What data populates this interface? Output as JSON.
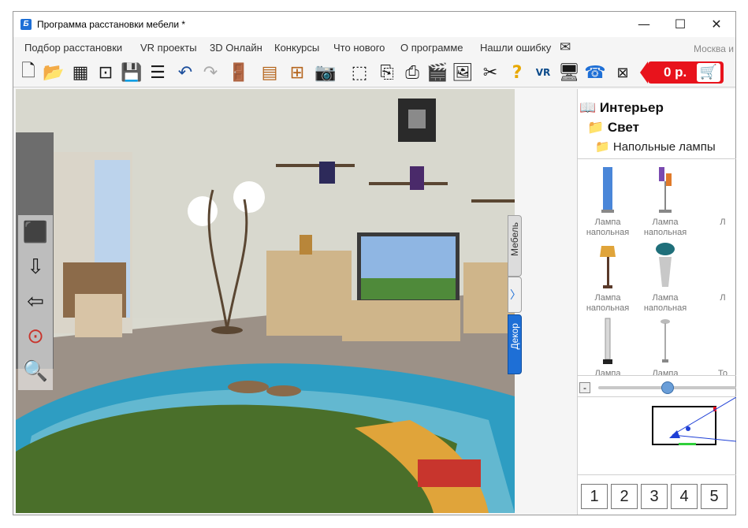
{
  "window": {
    "title": "Программа расстановки мебели *",
    "app_icon_letter": "Б",
    "minimize_glyph": "—",
    "maximize_glyph": "☐",
    "close_glyph": "✕"
  },
  "menu": {
    "items": [
      "Подбор расстановки",
      "VR проекты",
      "3D Онлайн",
      "Конкурсы",
      "Что нового",
      "О программе",
      "Нашли ошибку"
    ],
    "mail_icon": "✉",
    "city": "Москва и"
  },
  "toolbar": {
    "icons": [
      {
        "name": "new-file-icon",
        "glyph": "🗋"
      },
      {
        "name": "open-folder-icon",
        "glyph": "📂"
      },
      {
        "name": "plan-icon",
        "glyph": "▦"
      },
      {
        "name": "zoom-page-icon",
        "glyph": "⊡"
      },
      {
        "name": "save-icon",
        "glyph": "💾"
      },
      {
        "name": "list-icon",
        "glyph": "☰"
      },
      {
        "name": "undo-icon",
        "glyph": "↶"
      },
      {
        "name": "redo-icon",
        "glyph": "↷"
      },
      {
        "name": "door-icon",
        "glyph": "🚪"
      },
      {
        "name": "shelf-icon",
        "glyph": "▤"
      },
      {
        "name": "cabinet-icon",
        "glyph": "⊞"
      },
      {
        "name": "camera-icon",
        "glyph": "📷"
      },
      {
        "name": "cube-wire-icon",
        "glyph": "⬚"
      },
      {
        "name": "export-icon",
        "glyph": "⎘"
      },
      {
        "name": "print-icon",
        "glyph": "⎙"
      },
      {
        "name": "video-icon",
        "glyph": "🎬"
      },
      {
        "name": "image-icon",
        "glyph": "🖼"
      },
      {
        "name": "tools-icon",
        "glyph": "✂"
      },
      {
        "name": "help-icon",
        "glyph": "?"
      },
      {
        "name": "vr-icon",
        "glyph": "VR"
      },
      {
        "name": "monitor-icon",
        "glyph": "🖥"
      },
      {
        "name": "phone-icon",
        "glyph": "☎"
      },
      {
        "name": "close-box-icon",
        "glyph": "⊠"
      }
    ],
    "price": "0 р.",
    "cart_glyph": "🛒"
  },
  "viewport": {
    "tools": [
      {
        "name": "cube-view-icon",
        "glyph": "⬛"
      },
      {
        "name": "move-down-icon",
        "glyph": "⇩"
      },
      {
        "name": "move-side-icon",
        "glyph": "⇦"
      },
      {
        "name": "zoom-target-icon",
        "glyph": "⊙"
      },
      {
        "name": "magnifier-icon",
        "glyph": "🔍"
      }
    ],
    "tab_furniture": "Мебель",
    "tab_decor": "Декор",
    "tab_arrow": "〉"
  },
  "tree": {
    "book_glyph": "📖",
    "folder_glyph": "📁",
    "root": "Интерьер",
    "child": "Свет",
    "grandchild": "Напольные лампы"
  },
  "catalog": {
    "items": [
      {
        "label": "Лампа напольная",
        "glyph": "🕯"
      },
      {
        "label": "Лампа напольная",
        "glyph": "🕯"
      },
      {
        "label": "Л",
        "glyph": ""
      },
      {
        "label": "Лампа напольная",
        "glyph": "🕯"
      },
      {
        "label": "Лампа напольная",
        "glyph": "🕯"
      },
      {
        "label": "Л",
        "glyph": ""
      },
      {
        "label": "Лампа",
        "glyph": "🕯"
      },
      {
        "label": "Лампа",
        "glyph": "🕯"
      },
      {
        "label": "То",
        "glyph": ""
      }
    ]
  },
  "zoom": {
    "minus": "-",
    "level": 0.5
  },
  "views": [
    "1",
    "2",
    "3",
    "4",
    "5"
  ],
  "colors": {
    "price_red": "#e8131c",
    "accent_blue": "#1e6fd6"
  }
}
